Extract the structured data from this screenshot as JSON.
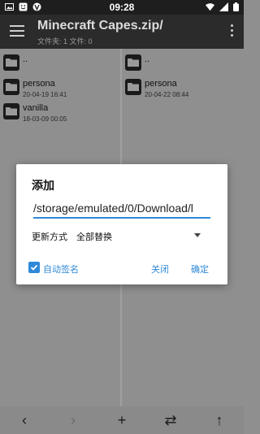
{
  "status_bar": {
    "time": "09:28",
    "left_icons": [
      "image-icon",
      "smiley-icon",
      "vpn-icon"
    ],
    "right_icons": [
      "wifi-icon",
      "signal-icon",
      "battery-icon"
    ]
  },
  "toolbar": {
    "title": "Minecraft Capes.zip/",
    "subtitle": "文件夹: 1  文件: 0"
  },
  "left_pane": {
    "items": [
      {
        "name": "..",
        "date": ""
      },
      {
        "name": "persona",
        "date": "20-04-19 16:41"
      },
      {
        "name": "vanilla",
        "date": "18-03-09 00:05"
      }
    ]
  },
  "right_pane": {
    "items": [
      {
        "name": "..",
        "date": ""
      },
      {
        "name": "persona",
        "date": "20-04-22 08:44"
      }
    ]
  },
  "bottom_bar": {
    "buttons": [
      "‹",
      "›",
      "+",
      "⇄",
      "↑"
    ]
  },
  "dialog": {
    "title": "添加",
    "path_value": "/storage/emulated/0/Download/l",
    "update_label": "更新方式",
    "update_value": "全部替换",
    "auto_sign_label": "自动签名",
    "auto_sign_checked": true,
    "close_label": "关闭",
    "ok_label": "确定"
  },
  "colors": {
    "accent": "#2f89d8",
    "toolbar": "#2b2b2b",
    "statusbar": "#1e1e1e",
    "scrim_bg": "#8f8f8f"
  }
}
